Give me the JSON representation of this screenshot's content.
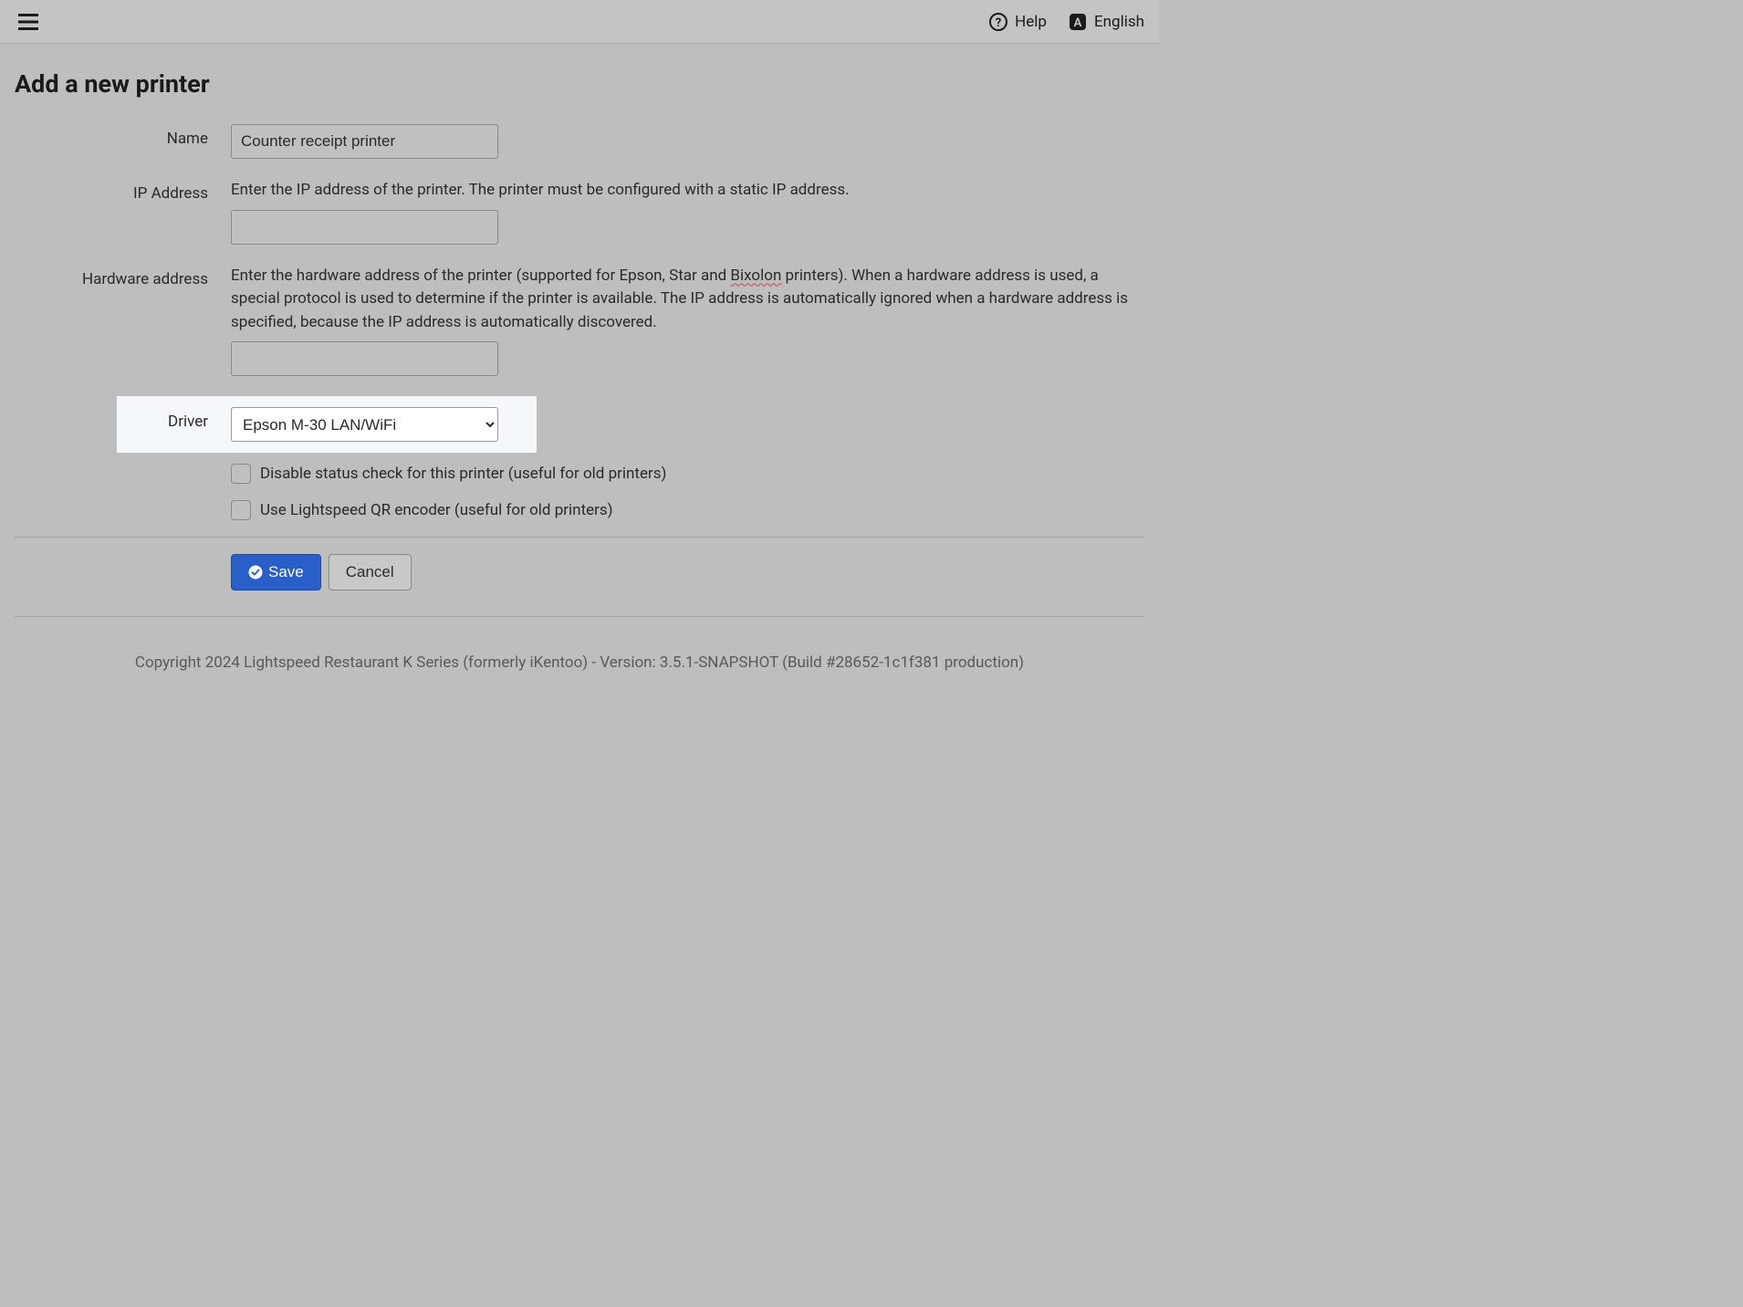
{
  "header": {
    "help_label": "Help",
    "language_label": "English"
  },
  "page": {
    "title": "Add a new printer"
  },
  "form": {
    "name": {
      "label": "Name",
      "value": "Counter receipt printer"
    },
    "ip_address": {
      "label": "IP Address",
      "help": "Enter the IP address of the printer. The printer must be configured with a static IP address.",
      "value": ""
    },
    "hardware_address": {
      "label": "Hardware address",
      "help_pre": "Enter the hardware address of the printer (supported for Epson, Star and ",
      "help_word": "Bixolon",
      "help_post": " printers). When a hardware address is used, a special protocol is used to determine if the printer is available. The IP address is automatically ignored when a hardware address is specified, because the IP address is automatically discovered.",
      "value": ""
    },
    "driver": {
      "label": "Driver",
      "value": "Epson M-30 LAN/WiFi"
    },
    "disable_status_label": "Disable status check for this printer (useful for old printers)",
    "qr_encoder_label": "Use Lightspeed QR encoder (useful for old printers)"
  },
  "buttons": {
    "save": "Save",
    "cancel": "Cancel"
  },
  "footer": {
    "copyright": "Copyright 2024 Lightspeed Restaurant K Series (formerly iKentoo) - Version: 3.5.1-SNAPSHOT (Build #28652-1c1f381 production)"
  }
}
